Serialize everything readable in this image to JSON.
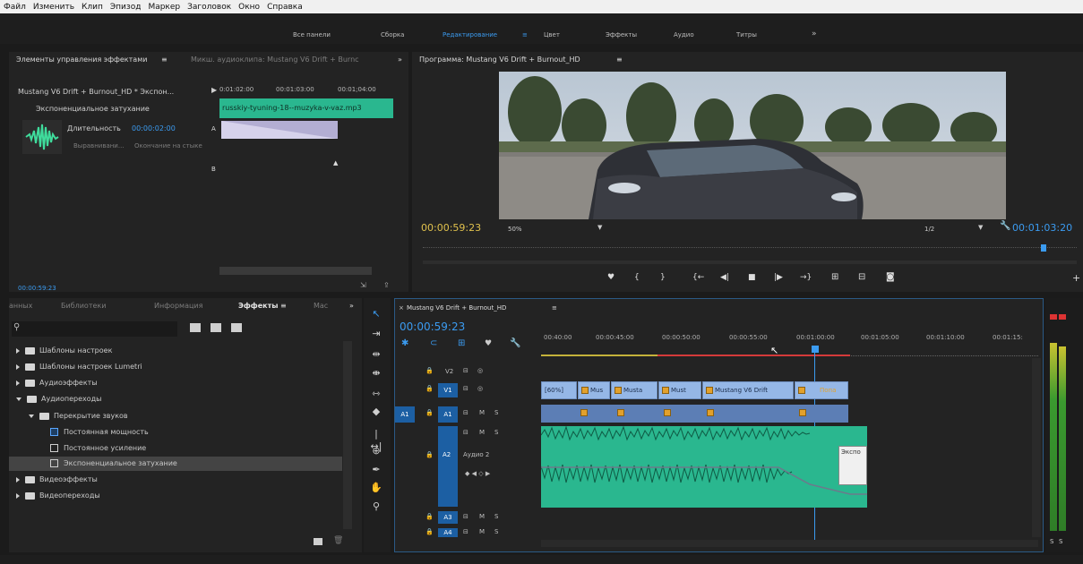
{
  "menu": [
    "Файл",
    "Изменить",
    "Клип",
    "Эпизод",
    "Маркер",
    "Заголовок",
    "Окно",
    "Справка"
  ],
  "workspaces": {
    "all_panels": "Все панели",
    "items": [
      "Сборка",
      "Редактирование",
      "Цвет",
      "Эффекты",
      "Аудио",
      "Титры"
    ],
    "active": "Редактирование",
    "more": "»"
  },
  "effect_controls": {
    "tab_active": "Элементы управления эффектами",
    "tab_inactive": "Микш. аудиоклипа: Mustang V6 Drift + Burnc",
    "more": "»",
    "sequence": "Mustang V6 Drift + Burnout_HD * Экспон...",
    "ruler": [
      "0:01:02:00",
      "00:01:03:00",
      "00:01;04:00"
    ],
    "effect_name": "Экспоненциальное затухание",
    "duration_label": "Длительность",
    "duration_value": "00:00:02:00",
    "align_label": "Выравнивани...",
    "align_value": "Окончание на стыке",
    "clip_label": "russkiy-tyuning-18--muzyka-v-vaz.mp3",
    "label_a": "A",
    "label_b": "B",
    "timecode": "00:00:59:23"
  },
  "program": {
    "title": "Программа: Mustang V6 Drift + Burnout_HD",
    "timecode": "00:00:59:23",
    "zoom": "50%",
    "resolution": "1/2",
    "duration": "00:01:03:20"
  },
  "effects_panel": {
    "tabs": [
      "анных",
      "Библиотеки",
      "Информация",
      "Эффекты",
      "Мас"
    ],
    "active_tab": "Эффекты",
    "more": "»",
    "search_placeholder": "",
    "tree": [
      {
        "label": "Шаблоны настроек",
        "type": "folder-star",
        "expanded": false
      },
      {
        "label": "Шаблоны настроек Lumetri",
        "type": "folder-star",
        "expanded": false
      },
      {
        "label": "Аудиоэффекты",
        "type": "folder",
        "expanded": false
      },
      {
        "label": "Аудиопереходы",
        "type": "folder",
        "expanded": true
      },
      {
        "label": "Перекрытие звуков",
        "type": "folder",
        "expanded": true
      },
      {
        "label": "Постоянная мощность",
        "type": "effect"
      },
      {
        "label": "Постоянное усиление",
        "type": "effect"
      },
      {
        "label": "Экспоненциальное затухание",
        "type": "effect",
        "selected": true
      },
      {
        "label": "Видеоэффекты",
        "type": "folder",
        "expanded": false
      },
      {
        "label": "Видеопереходы",
        "type": "folder",
        "expanded": false
      }
    ]
  },
  "timeline": {
    "title": "Mustang V6 Drift + Burnout_HD",
    "timecode": "00:00:59:23",
    "ruler": [
      "00:40:00",
      "00:00:45:00",
      "00:00:50:00",
      "00:00:55:00",
      "00:01:00:00",
      "00:01:05:00",
      "00:01:10:00",
      "00:01:15:"
    ],
    "tracks": {
      "v2": "V2",
      "v1": "V1",
      "a1_src": "A1",
      "a1": "A1",
      "a2": "A2",
      "a2_name": "Аудио 2",
      "a3": "A3",
      "a4": "A4",
      "m": "M",
      "s": "S"
    },
    "video_clips": [
      "[60%]",
      "Mus",
      "Musta",
      "Must",
      "Mustang V6 Drift",
      "Попа"
    ],
    "transition_label": "Экспо"
  },
  "meter_labels": [
    "S",
    "S"
  ],
  "colors": {
    "accent": "#3b9bf0",
    "audio_clip": "#2ab78f",
    "video_clip": "#95b7e6",
    "track_selected": "#1c5fa3"
  }
}
